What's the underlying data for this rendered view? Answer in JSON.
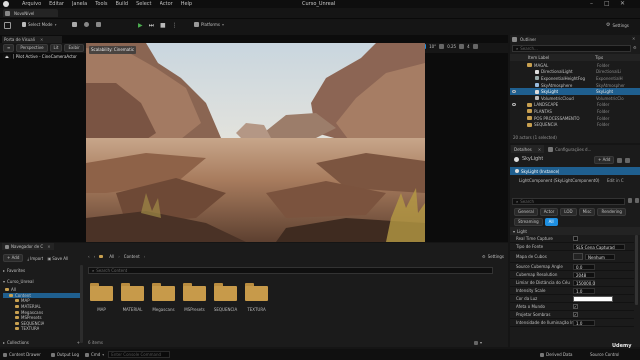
{
  "menubar": {
    "items": [
      "Arquivo",
      "Editar",
      "Janela",
      "Tools",
      "Build",
      "Select",
      "Actor",
      "Help"
    ],
    "project": "Curso_Unreal",
    "window_controls": [
      "minimize-icon",
      "maximize-icon",
      "close-icon"
    ]
  },
  "tabs": {
    "level": "NovoNível"
  },
  "toolbar": {
    "select_mode": "Select Mode",
    "platforms": "Platforms",
    "settings": "Settings"
  },
  "viewport": {
    "tab": "Porta de Visuali",
    "perspective": "Perspective",
    "lit": "Lit",
    "show": "Exibir",
    "pilot": "[ Pilot Active - CineCameraActor",
    "scalability": "Scalability: Cinematic",
    "snap_value": "10",
    "rot_value": "10°",
    "scale_value": "0.25",
    "cam_speed": "4"
  },
  "outliner": {
    "title": "Outliner",
    "search_placeholder": "Search...",
    "col_label": "Item Label",
    "col_type": "Tipo",
    "rows": [
      {
        "label": "MAGAL",
        "type": "Folder",
        "indent": 1,
        "kind": "folder",
        "eye": false,
        "sel": false
      },
      {
        "label": "DirectionalLight",
        "type": "DirectionalLi",
        "indent": 2,
        "kind": "light",
        "eye": false,
        "sel": false
      },
      {
        "label": "ExponentialHeightFog",
        "type": "ExponentialH",
        "indent": 2,
        "kind": "fog",
        "eye": false,
        "sel": false
      },
      {
        "label": "SkyAtmosphere",
        "type": "SkyAtmospher",
        "indent": 2,
        "kind": "sky",
        "eye": false,
        "sel": false
      },
      {
        "label": "SkyLight",
        "type": "SkyLight",
        "indent": 2,
        "kind": "skylight",
        "eye": true,
        "sel": true
      },
      {
        "label": "VolumetricCloud",
        "type": "VolumetricClo",
        "indent": 2,
        "kind": "cloud",
        "eye": false,
        "sel": false
      },
      {
        "label": "LANDSCAPE",
        "type": "Folder",
        "indent": 1,
        "kind": "folder",
        "eye": true,
        "sel": false
      },
      {
        "label": "PLANTAS",
        "type": "Folder",
        "indent": 1,
        "kind": "folder",
        "eye": false,
        "sel": false
      },
      {
        "label": "POS PROCESSAMENTO",
        "type": "Folder",
        "indent": 1,
        "kind": "folder",
        "eye": false,
        "sel": false
      },
      {
        "label": "SEQUENCIA",
        "type": "Folder",
        "indent": 1,
        "kind": "folder",
        "eye": false,
        "sel": false
      }
    ],
    "status": "20 actors (1 selected)"
  },
  "details": {
    "tab1": "Detalhes",
    "tab2": "Configurações d...",
    "actor_name": "SkyLight",
    "add_label": "+ Add",
    "instance": "SkyLight (Instance)",
    "component": "LightComponent (SkyLightComponent0)",
    "edit_label": "Edit in C",
    "search_placeholder": "Search",
    "filters": [
      "General",
      "Actor",
      "LOD",
      "Misc",
      "Rendering",
      "Streaming",
      "All"
    ],
    "section": "Light",
    "props": [
      {
        "label": "Real Time Capture",
        "kind": "check",
        "value": ""
      },
      {
        "label": "Tipo de Fonte",
        "kind": "dropdown",
        "value": "SLS Cena Capturad"
      },
      {
        "label": "Mapa de Cubos",
        "kind": "asset",
        "value": "Nenhum"
      },
      {
        "label": "Source Cubemap Angle",
        "kind": "field",
        "value": "0.0"
      },
      {
        "label": "Cubemap Resolution",
        "kind": "field",
        "value": "2048"
      },
      {
        "label": "Limiar de Distância do Céu",
        "kind": "field",
        "value": "150000.0"
      },
      {
        "label": "Intensity Scale",
        "kind": "field",
        "value": "1.0"
      },
      {
        "label": "Cor da Luz",
        "kind": "color",
        "value": ""
      },
      {
        "label": "Afeta o Mundo",
        "kind": "check",
        "value": "✓"
      },
      {
        "label": "Projetar Sombras",
        "kind": "check",
        "value": "✓"
      },
      {
        "label": "Intensidade de Iluminação Indir",
        "kind": "field",
        "value": "1.0"
      }
    ]
  },
  "content_browser": {
    "tab": "Navegador de C",
    "add_label": "+ Add",
    "import_label": "Import",
    "save_all_label": "Save All",
    "path": [
      "All",
      "Content"
    ],
    "settings_label": "Settings",
    "search_placeholder": "Search Content",
    "favorites": "Favorites",
    "project": "Curso_Unreal",
    "tree": [
      "All",
      "Content",
      "MAP",
      "MATERIAL",
      "Megascans",
      "MSPresets",
      "SEQUENCIA",
      "TEXTURA"
    ],
    "folders": [
      "MAP",
      "MATERIAL",
      "Megascans",
      "MSPresets",
      "SEQUENCIA",
      "TEXTURA"
    ],
    "item_count": "6 items",
    "collections": "Collections"
  },
  "statusbar": {
    "content_drawer": "Content Drawer",
    "output_log": "Output Log",
    "cmd": "Cmd",
    "console_placeholder": "Enter Console Command",
    "derived": "Derived Data",
    "source_control": "Source Control"
  },
  "watermark": "Udemy",
  "colors": {
    "accent": "#1e8fe1",
    "selection": "#1f5f8f",
    "folder": "#c79a4a",
    "play": "#4caf50"
  }
}
